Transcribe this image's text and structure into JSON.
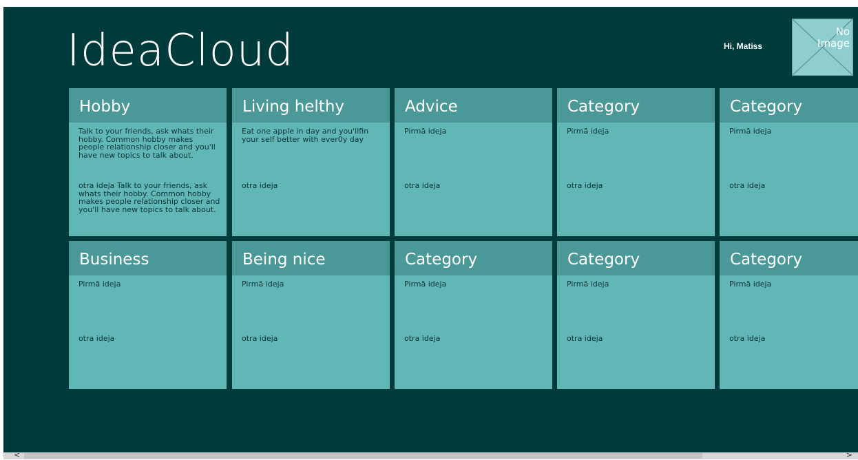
{
  "app": {
    "title": "IdeaCloud"
  },
  "header": {
    "greeting": "Hi, Matiss",
    "avatar_text": "No Image"
  },
  "tiles": [
    {
      "title": "Hobby",
      "first_idea": "Talk to your friends, ask whats their hobby. Common hobby makes people relationship closer and you'll have new topics to talk about.",
      "second_idea": "otra ideja Talk to your friends, ask whats their hobby. Common hobby makes people relationship closer and you'll have new topics to talk about."
    },
    {
      "title": "Living helthy",
      "first_idea": "Eat one apple in day and you'llfin your self better with ever0y day",
      "second_idea": "otra ideja"
    },
    {
      "title": "Advice",
      "first_idea": "Pirmā ideja",
      "second_idea": "otra ideja"
    },
    {
      "title": "Category",
      "first_idea": "Pirmā ideja",
      "second_idea": "otra ideja"
    },
    {
      "title": "Category",
      "first_idea": "Pirmā ideja",
      "second_idea": "otra ideja"
    },
    {
      "title": "Business",
      "first_idea": "Pirmā ideja",
      "second_idea": "otra ideja"
    },
    {
      "title": "Being nice",
      "first_idea": "Pirmā ideja",
      "second_idea": "otra ideja"
    },
    {
      "title": "Category",
      "first_idea": "Pirmā ideja",
      "second_idea": "otra ideja"
    },
    {
      "title": "Category",
      "first_idea": "Pirmā ideja",
      "second_idea": "otra ideja"
    },
    {
      "title": "Category",
      "first_idea": "Pirmā ideja",
      "second_idea": "otra ideja"
    }
  ],
  "scrollbar": {
    "left_arrow": "<",
    "right_arrow": ">"
  },
  "colors": {
    "background": "#003b3b",
    "tile": "#61b6b6",
    "tile_header": "#4b9898"
  }
}
